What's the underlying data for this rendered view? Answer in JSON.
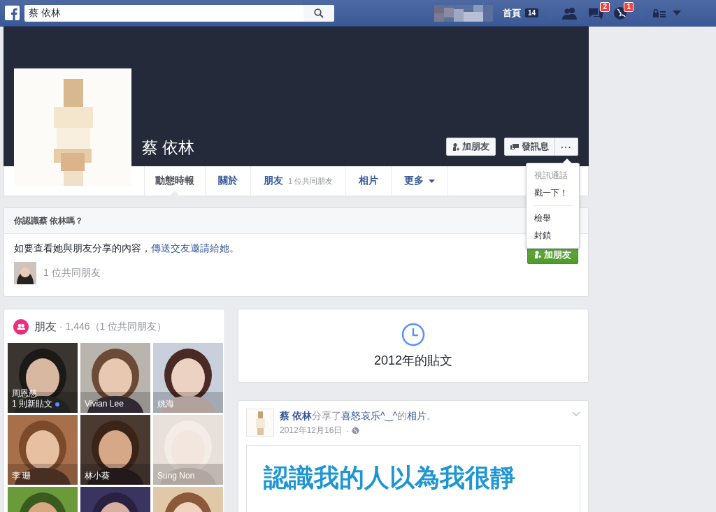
{
  "top_bar": {
    "search": {
      "value": "蔡 依林"
    },
    "home": {
      "label": "首頁",
      "badge": "14"
    },
    "icons": [
      {
        "kind": "friends"
      },
      {
        "kind": "messages",
        "badge": "2"
      },
      {
        "kind": "globe",
        "badge": "1"
      }
    ]
  },
  "profile": {
    "name": "蔡 依林",
    "actions": [
      {
        "kind": "add-friend",
        "label": "加朋友"
      },
      {
        "kind": "message",
        "label": "發訊息"
      },
      {
        "kind": "more",
        "label": "···"
      }
    ],
    "tabs": [
      {
        "label": "動態時報",
        "selected": true
      },
      {
        "label": "關於",
        "selected": false
      },
      {
        "label": "朋友",
        "note": "1 位共同朋友",
        "selected": false
      },
      {
        "label": "相片",
        "selected": false
      },
      {
        "label": "更多",
        "dropdown": true,
        "selected": false
      }
    ],
    "menu": [
      [
        {
          "label": "視訊通話",
          "disabled": true
        },
        {
          "label": "戳一下！",
          "disabled": false
        }
      ],
      [
        {
          "label": "檢舉",
          "disabled": false
        },
        {
          "label": "封鎖",
          "disabled": false
        }
      ]
    ]
  },
  "know_card": {
    "title": "你認識蔡 依林嗎？",
    "text": "如要查看她與朋友分享的內容，",
    "link": "傳送交友邀請給她。",
    "mutual": "1 位共同朋友",
    "button": "加朋友"
  },
  "friends": {
    "title": "朋友",
    "count": "· 1,446（1 位共同朋友）",
    "tiles": [
      {
        "name": "周恩慈",
        "note": "1 則新貼文",
        "new_post": true
      },
      {
        "name": "Vivian Lee",
        "new_post": false
      },
      {
        "name": "姚海",
        "new_post": false
      },
      {
        "name": "李 珊",
        "new_post": false
      },
      {
        "name": "林小葵",
        "new_post": false
      },
      {
        "name": "Sung Non",
        "new_post": false
      },
      {
        "new_post": false
      },
      {
        "new_post": false
      },
      {
        "new_post": false
      }
    ]
  },
  "timeline": {
    "label": "2012年的貼文"
  },
  "post": {
    "headline": [
      {
        "kind": "author",
        "text": "蔡 依林"
      },
      {
        "kind": "plain",
        "text": "分享了"
      },
      {
        "kind": "link",
        "text": "喜怒哀乐^‿^"
      },
      {
        "kind": "plain",
        "text": "的"
      },
      {
        "kind": "link",
        "text": "相片"
      },
      {
        "kind": "plain",
        "text": "。"
      }
    ],
    "date": "2012年12月16日",
    "separator": "·",
    "photo_text": [
      "認識我的人以為我很靜"
    ]
  }
}
